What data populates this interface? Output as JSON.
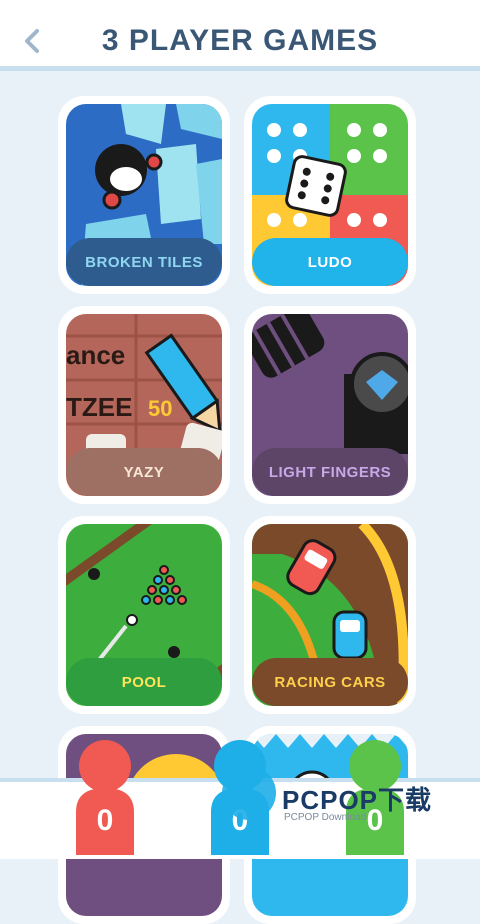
{
  "header": {
    "title": "3 PLAYER GAMES"
  },
  "games": [
    {
      "label": "BROKEN TILES",
      "pill_color": "#2f5c8e",
      "text_color": "#8fd6f0"
    },
    {
      "label": "LUDO",
      "pill_color": "#21b4ea",
      "text_color": "#ffffff"
    },
    {
      "label": "YAZY",
      "pill_color": "#9e6f63",
      "text_color": "#f7e7d4"
    },
    {
      "label": "LIGHT FINGERS",
      "pill_color": "#5c4566",
      "text_color": "#c7a8e8"
    },
    {
      "label": "POOL",
      "pill_color": "#2e9e3e",
      "text_color": "#ffe45c"
    },
    {
      "label": "RACING CARS",
      "pill_color": "#7a4a2a",
      "text_color": "#ffd04a"
    }
  ],
  "players": [
    {
      "score": "0",
      "color": "#f05a52"
    },
    {
      "score": "0",
      "color": "#1eaee8"
    },
    {
      "score": "0",
      "color": "#5cc34a"
    }
  ],
  "watermark": {
    "brand": "PCPOP下载",
    "sub": "PCPOP Download"
  },
  "icons": {
    "back": "chevron-left-icon",
    "player": "player-pawn-icon"
  }
}
